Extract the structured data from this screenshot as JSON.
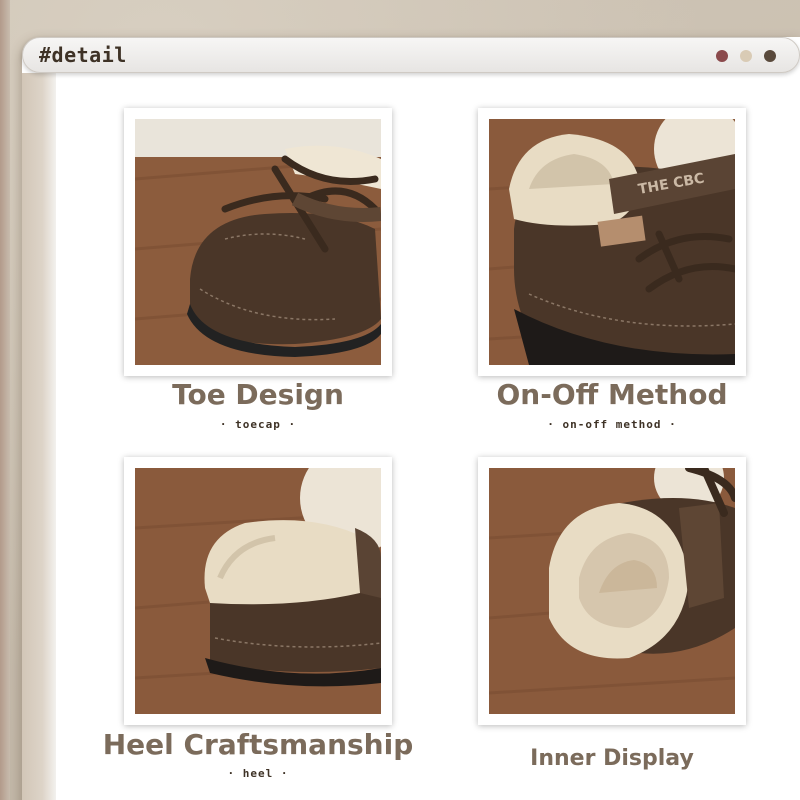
{
  "window": {
    "title": "#detail",
    "buttons": [
      {
        "name": "close",
        "color": "#8b4a4c"
      },
      {
        "name": "minimize",
        "color": "#d9cbb5"
      },
      {
        "name": "maximize",
        "color": "#5a4a3c"
      }
    ]
  },
  "details": [
    {
      "title": "Toe Design",
      "subtitle": "· toecap ·",
      "image": "toe-photo"
    },
    {
      "title": "On-Off Method",
      "subtitle": "· on-off method ·",
      "image": "strap-photo"
    },
    {
      "title": "Heel Craftsmanship",
      "subtitle": "· heel ·",
      "image": "heel-photo"
    },
    {
      "title": "Inner Display",
      "subtitle": "",
      "image": "inner-photo"
    }
  ],
  "photos": {
    "strap_text": "THE CBC"
  },
  "colors": {
    "suede": "#4a3628",
    "fleece": "#e8dcc4",
    "floor": "#8a5a3c",
    "label": "#7b6b5b",
    "subtitle": "#3e3226"
  }
}
